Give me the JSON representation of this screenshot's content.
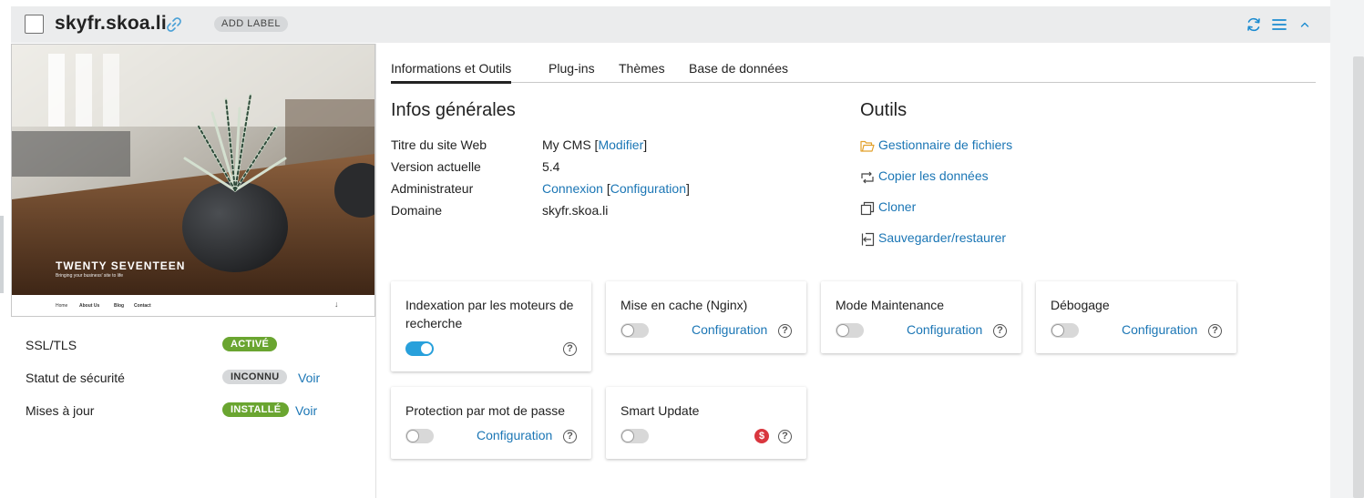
{
  "header": {
    "domain": "skyfr.skoa.li",
    "add_label": "ADD LABEL"
  },
  "preview": {
    "theme_name": "TWENTY SEVENTEEN",
    "tagline": "Bringing your business' site to life",
    "menu": [
      "Home",
      "About Us",
      "Blog",
      "Contact"
    ],
    "menu_arrow": "↓"
  },
  "status": {
    "ssl_label": "SSL/TLS",
    "ssl_badge": "ACTIVÉ",
    "security_label": "Statut de sécurité",
    "security_badge": "INCONNU",
    "security_link": "Voir",
    "updates_label": "Mises à jour",
    "updates_badge": "INSTALLÉ",
    "updates_link": "Voir"
  },
  "tabs": [
    "Informations et Outils",
    "Plug-ins",
    "Thèmes",
    "Base de données"
  ],
  "info": {
    "title": "Infos générales",
    "rows": [
      {
        "label": "Titre du site Web",
        "value": "My CMS",
        "link": "Modifier"
      },
      {
        "label": "Version actuelle",
        "value": "5.4"
      },
      {
        "label": "Administrateur",
        "link1": "Connexion",
        "link2": "Configuration"
      },
      {
        "label": "Domaine",
        "link": "skyfr.skoa.li"
      }
    ]
  },
  "tools": {
    "title": "Outils",
    "items": [
      "Gestionnaire de fichiers",
      "Copier les données",
      "Cloner",
      "Sauvegarder/restaurer"
    ]
  },
  "tiles": [
    {
      "title": "Indexation par les moteurs de recherche",
      "on": true
    },
    {
      "title": "Mise en cache (Nginx)",
      "config": "Configuration",
      "on": false
    },
    {
      "title": "Mode Maintenance",
      "config": "Configuration",
      "on": false
    },
    {
      "title": "Débogage",
      "config": "Configuration",
      "on": false
    },
    {
      "title": "Protection par mot de passe",
      "config": "Configuration",
      "on": false
    },
    {
      "title": "Smart Update",
      "on": false,
      "paid_icon": "$"
    }
  ],
  "colors": {
    "accent": "#1b76b5",
    "badge_green": "#6aa530",
    "toggle_on": "#28a0db",
    "paid_red": "#d9363e"
  }
}
